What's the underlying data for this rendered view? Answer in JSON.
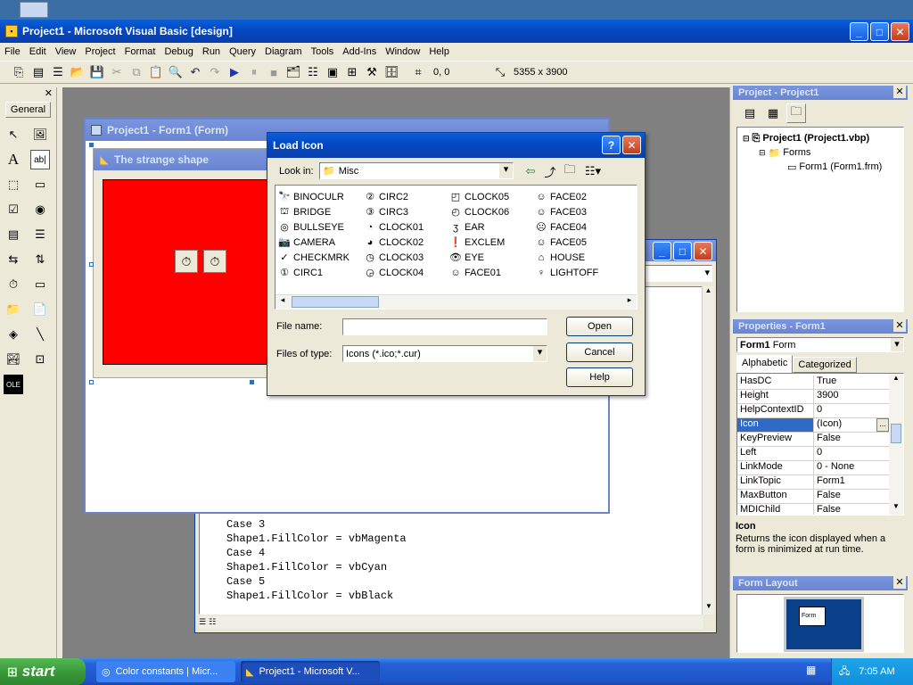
{
  "vb": {
    "title": "Project1 - Microsoft Visual Basic [design]",
    "menu": [
      "File",
      "Edit",
      "View",
      "Project",
      "Format",
      "Debug",
      "Run",
      "Query",
      "Diagram",
      "Tools",
      "Add-Ins",
      "Window",
      "Help"
    ],
    "coords": "0, 0",
    "size": "5355 x 3900"
  },
  "toolbox": {
    "tab": "General"
  },
  "form_designer": {
    "title": "Project1 - Form1 (Form)",
    "form_caption": "The strange shape",
    "fill_color": "#ff0000"
  },
  "code_window": {
    "lines": [
      "Case 3",
      "Shape1.FillColor = vbMagenta",
      "Case 4",
      "Shape1.FillColor = vbCyan",
      "Case 5",
      "Shape1.FillColor = vbBlack"
    ]
  },
  "dialog": {
    "title": "Load Icon",
    "look_in_label": "Look in:",
    "look_in_value": "Misc",
    "files": [
      [
        "BINOCULR",
        "BRIDGE",
        "BULLSEYE",
        "CAMERA",
        "CHECKMRK",
        "CIRC1"
      ],
      [
        "CIRC2",
        "CIRC3",
        "CLOCK01",
        "CLOCK02",
        "CLOCK03",
        "CLOCK04"
      ],
      [
        "CLOCK05",
        "CLOCK06",
        "EAR",
        "EXCLEM",
        "EYE",
        "FACE01"
      ],
      [
        "FACE02",
        "FACE03",
        "FACE04",
        "FACE05",
        "HOUSE",
        "LIGHTOFF"
      ]
    ],
    "file_icons": [
      [
        "🔭",
        "⛫",
        "◎",
        "📷",
        "✓",
        "①"
      ],
      [
        "②",
        "③",
        "◔",
        "◕",
        "◷",
        "◶"
      ],
      [
        "◰",
        "◴",
        "ʒ",
        "❗",
        "👁",
        "☺"
      ],
      [
        "☺",
        "☺",
        "☹",
        "☺",
        "⌂",
        "♀"
      ]
    ],
    "file_name_label": "File name:",
    "file_name_value": "",
    "files_of_type_label": "Files of type:",
    "files_of_type_value": "Icons (*.ico;*.cur)",
    "open": "Open",
    "cancel": "Cancel",
    "help": "Help"
  },
  "project_panel": {
    "title": "Project - Project1",
    "root": "Project1 (Project1.vbp)",
    "folder": "Forms",
    "item": "Form1 (Form1.frm)"
  },
  "properties": {
    "title": "Properties - Form1",
    "object": "Form1",
    "object_type": "Form",
    "tab_alpha": "Alphabetic",
    "tab_cat": "Categorized",
    "rows": [
      {
        "k": "HasDC",
        "v": "True"
      },
      {
        "k": "Height",
        "v": "3900"
      },
      {
        "k": "HelpContextID",
        "v": "0"
      },
      {
        "k": "Icon",
        "v": "(Icon)"
      },
      {
        "k": "KeyPreview",
        "v": "False"
      },
      {
        "k": "Left",
        "v": "0"
      },
      {
        "k": "LinkMode",
        "v": "0 - None"
      },
      {
        "k": "LinkTopic",
        "v": "Form1"
      },
      {
        "k": "MaxButton",
        "v": "False"
      },
      {
        "k": "MDIChild",
        "v": "False"
      }
    ],
    "desc_title": "Icon",
    "desc_text": "Returns the icon displayed when a form is minimized at run time."
  },
  "form_layout": {
    "title": "Form Layout",
    "preview": "Form"
  },
  "taskbar": {
    "start": "start",
    "tasks": [
      "Color constants | Micr...",
      "Project1 - Microsoft V..."
    ],
    "clock": "7:05 AM"
  }
}
